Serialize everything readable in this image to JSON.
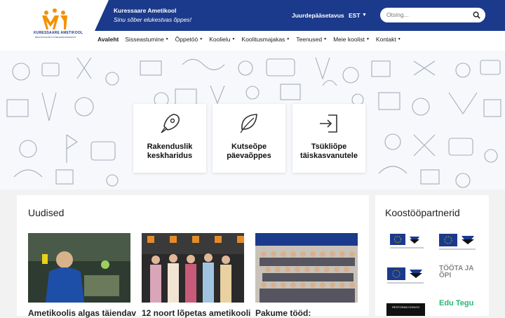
{
  "header": {
    "logo_text": "KURESSAARE AMETIKOOL",
    "logo_sub": "REGIONAALNE KUTSEHARIDUSKESKUS",
    "school_name": "Kuressaare Ametikool",
    "slogan": "Sinu sõber elukestvas õppes!",
    "accessibility": "Juurdepääsetavus",
    "language": "EST",
    "search_placeholder": "Otsing...",
    "colors": {
      "brand_blue": "#1b3a8c",
      "logo_orange": "#f39200"
    }
  },
  "nav": {
    "items": [
      {
        "label": "Avaleht",
        "active": true,
        "dropdown": false
      },
      {
        "label": "Sisseastumine",
        "dropdown": true
      },
      {
        "label": "Õppetöö",
        "dropdown": true
      },
      {
        "label": "Koolielu",
        "dropdown": true
      },
      {
        "label": "Koolitusmajakas",
        "dropdown": true
      },
      {
        "label": "Teenused",
        "dropdown": true
      },
      {
        "label": "Meie koolist",
        "dropdown": true
      },
      {
        "label": "Kontakt",
        "dropdown": true
      }
    ]
  },
  "hero": {
    "cards": [
      {
        "line1": "Rakenduslik",
        "line2": "keskharidus",
        "icon": "rocket-icon"
      },
      {
        "line1": "Kutseõpe",
        "line2": "päevaõppes",
        "icon": "leaf-icon"
      },
      {
        "line1": "Tsükliõpe",
        "line2": "täiskasvanutele",
        "icon": "sign-in-icon"
      }
    ]
  },
  "news": {
    "heading": "Uudised",
    "items": [
      {
        "title": "Ametikoolis algas täiendav"
      },
      {
        "title": "12 noort lõpetas ametikooli"
      },
      {
        "title": "Pakume tööd:"
      }
    ]
  },
  "partners": {
    "heading": "Koostööpartnerid",
    "logo4_text": "TÖÖTA JA ÕPI",
    "logo5_text": "RESTORAN KONVOI",
    "logo6_text": "Edu Tegu"
  }
}
